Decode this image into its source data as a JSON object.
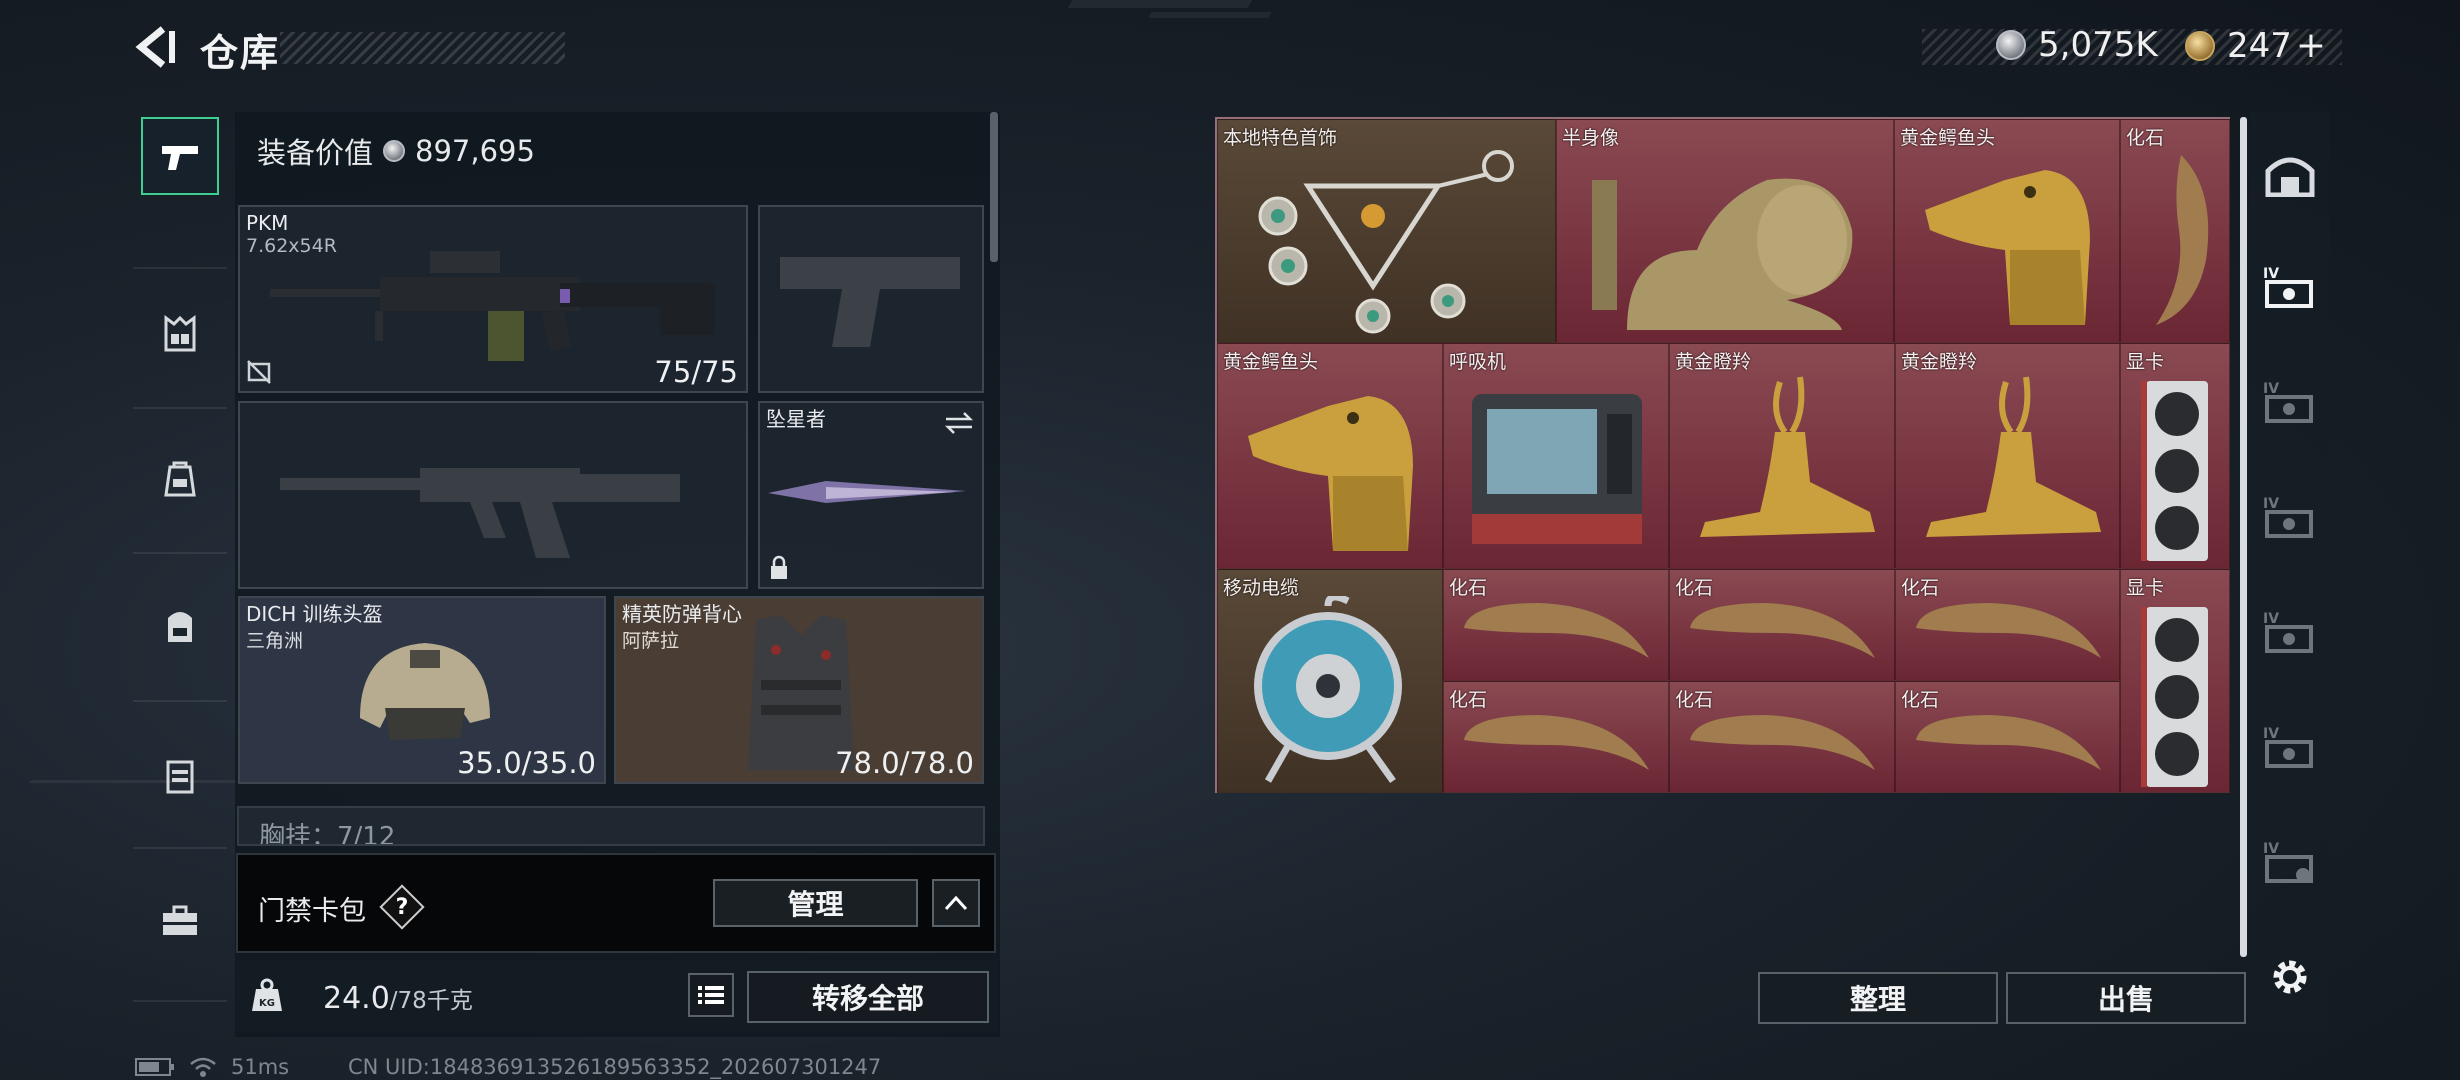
{
  "header": {
    "title": "仓库"
  },
  "currency": {
    "silver": "5,075K",
    "gold": "247",
    "gold_plus": "+"
  },
  "loadout": {
    "equipment_value_label": "装备价值",
    "equipment_value": "897,695",
    "primary": {
      "name": "PKM",
      "ammo": "7.62x54R",
      "count": "75/75"
    },
    "melee": {
      "name": "坠星者"
    },
    "helmet": {
      "name": "DICH 训练头盔",
      "brand": "三角洲",
      "durability": "35.0/35.0"
    },
    "armor": {
      "name": "精英防弹背心",
      "brand": "阿萨拉",
      "durability": "78.0/78.0"
    },
    "chest_rig": {
      "label": "胸挂：7/12"
    },
    "card_bag": {
      "label": "门禁卡包",
      "help": "?",
      "manage": "管理"
    },
    "weight": {
      "current": "24.0",
      "max": "/78千克",
      "kg": "KG"
    },
    "transfer_all": "转移全部"
  },
  "stash": {
    "items": [
      {
        "label": "本地特色首饰",
        "icon": "jewelry-icon"
      },
      {
        "label": "半身像",
        "icon": "bust-icon"
      },
      {
        "label": "黄金鳄鱼头",
        "icon": "croc-head-icon"
      },
      {
        "label": "化石",
        "icon": "claw-fossil-icon"
      },
      {
        "label": "黄金鳄鱼头",
        "icon": "croc-head-icon"
      },
      {
        "label": "呼吸机",
        "icon": "ventilator-icon"
      },
      {
        "label": "黄金瞪羚",
        "icon": "gazelle-icon"
      },
      {
        "label": "黄金瞪羚",
        "icon": "gazelle-icon"
      },
      {
        "label": "显卡",
        "icon": "gpu-icon"
      },
      {
        "label": "移动电缆",
        "icon": "cable-reel-icon"
      },
      {
        "label": "化石",
        "icon": "claw-fossil-icon"
      },
      {
        "label": "化石",
        "icon": "claw-fossil-icon"
      },
      {
        "label": "化石",
        "icon": "claw-fossil-icon"
      },
      {
        "label": "显卡",
        "icon": "gpu-icon"
      },
      {
        "label": "化石",
        "icon": "claw-fossil-icon"
      },
      {
        "label": "化石",
        "icon": "claw-fossil-icon"
      },
      {
        "label": "化石",
        "icon": "claw-fossil-icon"
      }
    ],
    "sort": "整理",
    "sell": "出售"
  },
  "status": {
    "ping": "51ms",
    "uid": "CN UID:1848369135261895633​52_202607301247"
  }
}
